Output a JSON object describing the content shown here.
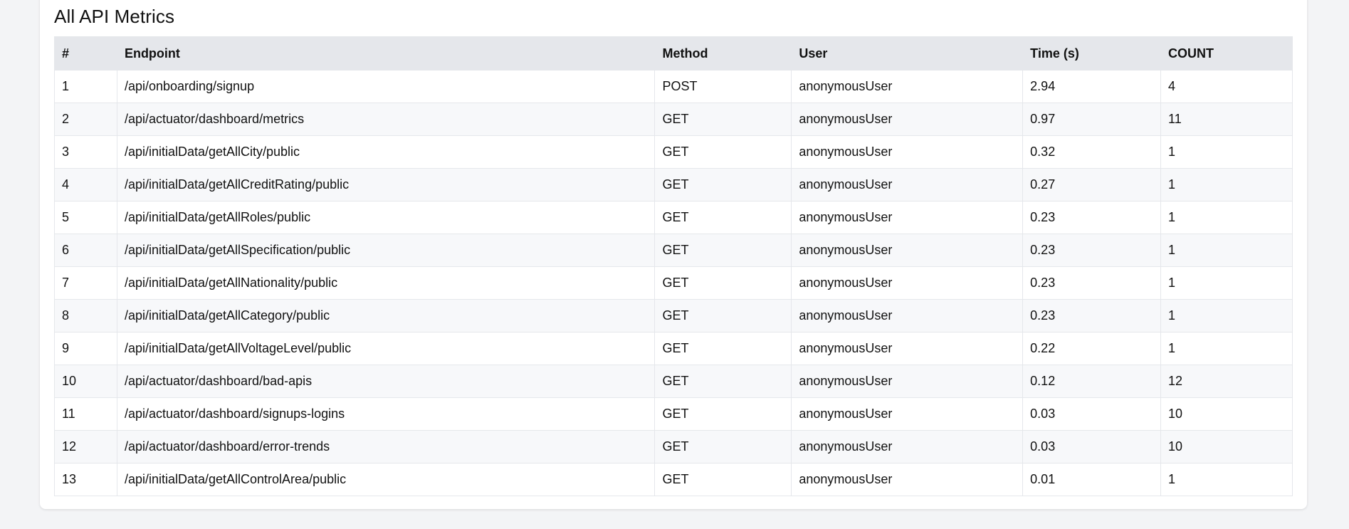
{
  "title": "All API Metrics",
  "headers": [
    "#",
    "Endpoint",
    "Method",
    "User",
    "Time (s)",
    "COUNT"
  ],
  "rows": [
    [
      "1",
      "/api/onboarding/signup",
      "POST",
      "anonymousUser",
      "2.94",
      "4"
    ],
    [
      "2",
      "/api/actuator/dashboard/metrics",
      "GET",
      "anonymousUser",
      "0.97",
      "11"
    ],
    [
      "3",
      "/api/initialData/getAllCity/public",
      "GET",
      "anonymousUser",
      "0.32",
      "1"
    ],
    [
      "4",
      "/api/initialData/getAllCreditRating/public",
      "GET",
      "anonymousUser",
      "0.27",
      "1"
    ],
    [
      "5",
      "/api/initialData/getAllRoles/public",
      "GET",
      "anonymousUser",
      "0.23",
      "1"
    ],
    [
      "6",
      "/api/initialData/getAllSpecification/public",
      "GET",
      "anonymousUser",
      "0.23",
      "1"
    ],
    [
      "7",
      "/api/initialData/getAllNationality/public",
      "GET",
      "anonymousUser",
      "0.23",
      "1"
    ],
    [
      "8",
      "/api/initialData/getAllCategory/public",
      "GET",
      "anonymousUser",
      "0.23",
      "1"
    ],
    [
      "9",
      "/api/initialData/getAllVoltageLevel/public",
      "GET",
      "anonymousUser",
      "0.22",
      "1"
    ],
    [
      "10",
      "/api/actuator/dashboard/bad-apis",
      "GET",
      "anonymousUser",
      "0.12",
      "12"
    ],
    [
      "11",
      "/api/actuator/dashboard/signups-logins",
      "GET",
      "anonymousUser",
      "0.03",
      "10"
    ],
    [
      "12",
      "/api/actuator/dashboard/error-trends",
      "GET",
      "anonymousUser",
      "0.03",
      "10"
    ],
    [
      "13",
      "/api/initialData/getAllControlArea/public",
      "GET",
      "anonymousUser",
      "0.01",
      "1"
    ]
  ]
}
